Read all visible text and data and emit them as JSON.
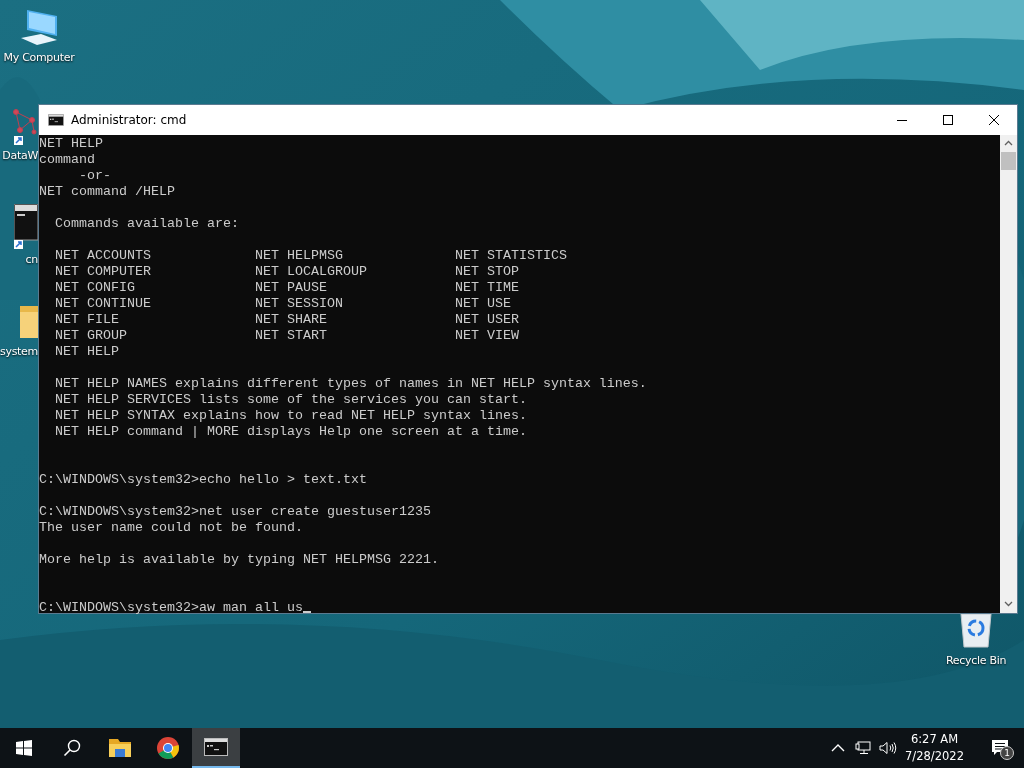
{
  "desktop_icons": [
    {
      "kind": "computer",
      "label": "My Computer"
    },
    {
      "kind": "network",
      "label": "DataW"
    },
    {
      "kind": "terminal",
      "label": "cn"
    },
    {
      "kind": "folder",
      "label": "system"
    }
  ],
  "recycle_bin": {
    "label": "Recycle Bin"
  },
  "window": {
    "title": "Administrator: cmd",
    "console": {
      "cursor": true,
      "lines": [
        {
          "kind": "text",
          "text": "NET HELP"
        },
        {
          "kind": "text",
          "text": "command"
        },
        {
          "kind": "text",
          "text": "     -or-"
        },
        {
          "kind": "text",
          "text": "NET command /HELP"
        },
        {
          "kind": "blank"
        },
        {
          "kind": "text",
          "text": "  Commands available are:"
        },
        {
          "kind": "blank"
        },
        {
          "kind": "text",
          "text": "  NET ACCOUNTS             NET HELPMSG              NET STATISTICS"
        },
        {
          "kind": "text",
          "text": "  NET COMPUTER             NET LOCALGROUP           NET STOP"
        },
        {
          "kind": "text",
          "text": "  NET CONFIG               NET PAUSE                NET TIME"
        },
        {
          "kind": "text",
          "text": "  NET CONTINUE             NET SESSION              NET USE"
        },
        {
          "kind": "text",
          "text": "  NET FILE                 NET SHARE                NET USER"
        },
        {
          "kind": "text",
          "text": "  NET GROUP                NET START                NET VIEW"
        },
        {
          "kind": "text",
          "text": "  NET HELP"
        },
        {
          "kind": "blank"
        },
        {
          "kind": "text",
          "text": "  NET HELP NAMES explains different types of names in NET HELP syntax lines."
        },
        {
          "kind": "text",
          "text": "  NET HELP SERVICES lists some of the services you can start."
        },
        {
          "kind": "text",
          "text": "  NET HELP SYNTAX explains how to read NET HELP syntax lines."
        },
        {
          "kind": "text",
          "text": "  NET HELP command | MORE displays Help one screen at a time."
        },
        {
          "kind": "blank"
        },
        {
          "kind": "blank"
        },
        {
          "kind": "text",
          "text": "C:\\WINDOWS\\system32>echo hello > text.txt"
        },
        {
          "kind": "blank"
        },
        {
          "kind": "text",
          "text": "C:\\WINDOWS\\system32>net user create guestuser1235"
        },
        {
          "kind": "text",
          "text": "The user name could not be found."
        },
        {
          "kind": "blank"
        },
        {
          "kind": "text",
          "text": "More help is available by typing NET HELPMSG 2221."
        },
        {
          "kind": "blank"
        },
        {
          "kind": "blank"
        },
        {
          "kind": "text",
          "text": "C:\\WINDOWS\\system32>aw man all us"
        }
      ]
    }
  },
  "taskbar": {
    "apps": [
      {
        "kind": "explorer",
        "active": false
      },
      {
        "kind": "browser",
        "active": false
      },
      {
        "kind": "terminal",
        "active": true
      }
    ],
    "time": "6:27 AM",
    "date": "7/28/2022",
    "notifications": "1"
  }
}
